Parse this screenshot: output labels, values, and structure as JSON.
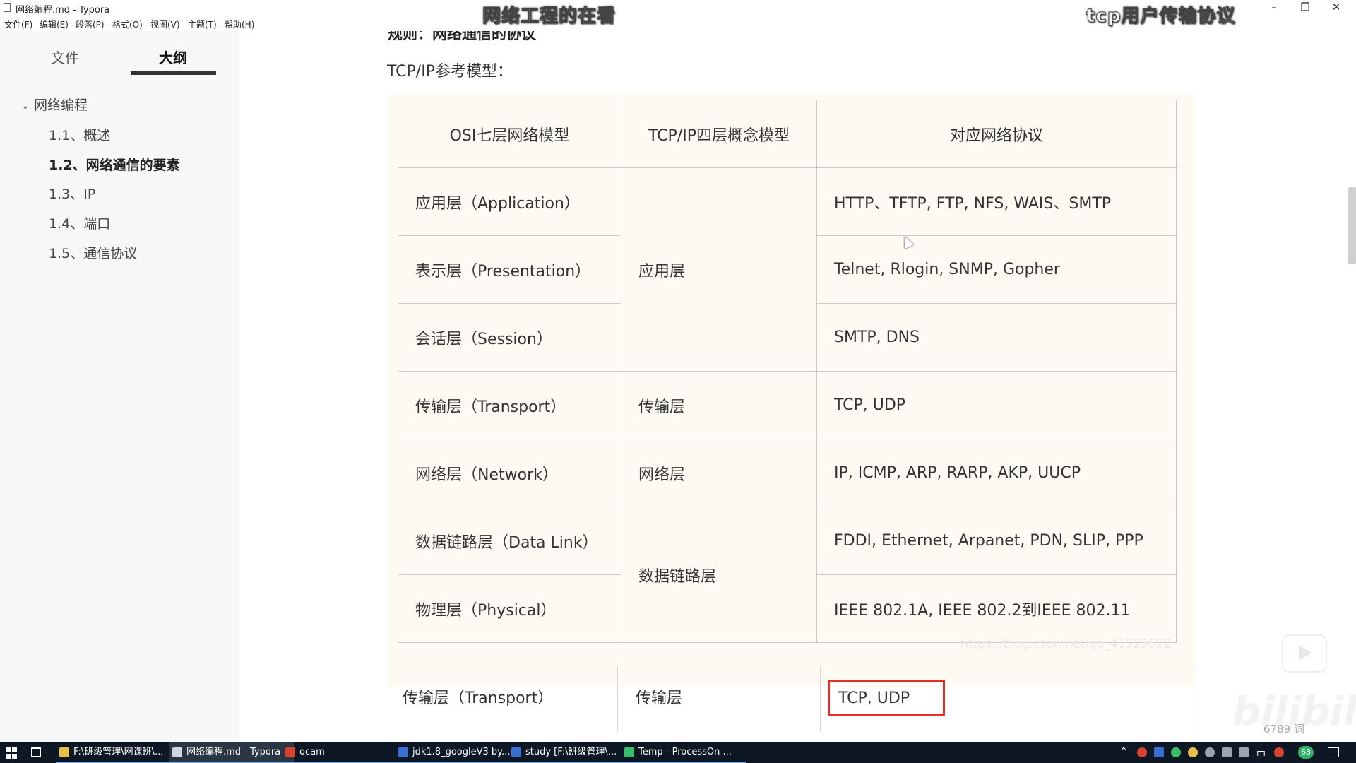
{
  "window": {
    "title": "网络编程.md - Typora",
    "controls": {
      "minimize": "–",
      "maximize": "❐",
      "close": "✕"
    }
  },
  "menu": [
    "文件(F)",
    "编辑(E)",
    "段落(P)",
    "格式(O)",
    "视图(V)",
    "主题(T)",
    "帮助(H)"
  ],
  "overlay_captions": {
    "left": "网络工程的在看",
    "right": "tcp用户传输协议"
  },
  "sidebar": {
    "tabs": [
      {
        "label": "文件"
      },
      {
        "label": "大纲"
      }
    ],
    "outline_root": "网络编程",
    "items": [
      {
        "label": "1.1、概述"
      },
      {
        "label": "1.2、网络通信的要素"
      },
      {
        "label": "1.3、IP"
      },
      {
        "label": "1.4、端口"
      },
      {
        "label": "1.5、通信协议"
      }
    ],
    "footer": {
      "back": "‹",
      "source": "</>"
    }
  },
  "content": {
    "cut_heading": "规则：网络通信的协议",
    "model_label": "TCP/IP参考模型：",
    "table": {
      "headers": [
        "OSI七层网络模型",
        "TCP/IP四层概念模型",
        "对应网络协议"
      ],
      "osi_layers": [
        "应用层（Application）",
        "表示层（Presentation）",
        "会话层（Session）",
        "传输层（Transport）",
        "网络层（Network）",
        "数据链路层（Data Link）",
        "物理层（Physical）"
      ],
      "tcpip_layers": [
        "应用层",
        "传输层",
        "网络层",
        "数据链路层"
      ],
      "protocols": [
        "HTTP、TFTP, FTP, NFS, WAIS、SMTP",
        "Telnet, Rlogin, SNMP, Gopher",
        "SMTP, DNS",
        "TCP, UDP",
        "IP, ICMP, ARP, RARP, AKP, UUCP",
        "FDDI, Ethernet, Arpanet, PDN, SLIP, PPP",
        "IEEE 802.1A, IEEE 802.2到IEEE 802.11"
      ]
    },
    "watermark": "https://blog.csdn.net/qq_41923622",
    "table2": {
      "osi": "传输层（Transport）",
      "tcpip": "传输层",
      "protocol": "TCP, UDP"
    },
    "word_count": "6789 词"
  },
  "taskbar": {
    "items": [
      {
        "label": "F:\\班级管理\\网课班\\...",
        "color": "#e8c04a"
      },
      {
        "label": "网络编程.md - Typora",
        "color": "#cfd6de"
      },
      {
        "label": "ocam",
        "color": "#d8432f"
      },
      {
        "label": "jdk1.8_googleV3 by...",
        "color": "#3a6fd1"
      },
      {
        "label": "study [F:\\班级管理\\...",
        "color": "#3a6fd1"
      },
      {
        "label": "Temp - ProcessOn ...",
        "color": "#3bbd6a"
      }
    ],
    "tray_badge": "68",
    "ime": "中"
  }
}
